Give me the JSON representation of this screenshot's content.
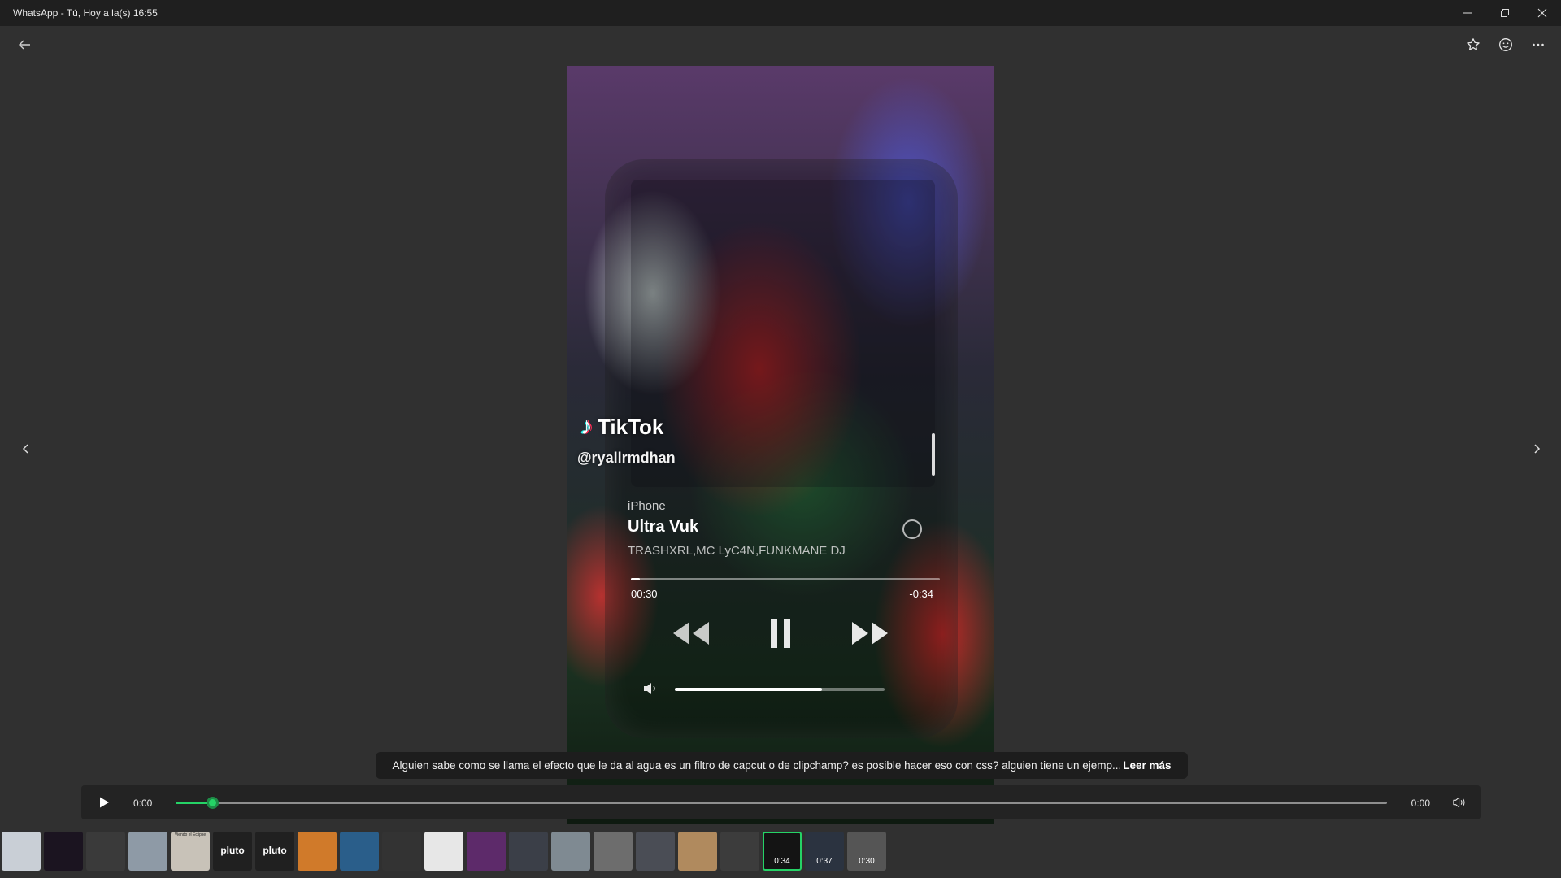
{
  "window": {
    "title": "WhatsApp - Tú, Hoy a la(s) 16:55"
  },
  "video": {
    "tiktok_brand": "TikTok",
    "tiktok_handle": "@ryallrmdhan",
    "now_playing": {
      "device": "iPhone",
      "song": "Ultra Vuk",
      "artists": "TRASHXRL,MC LyC4N,FUNKMANE DJ",
      "elapsed": "00:30",
      "remaining": "-0:34",
      "progress": 0.03,
      "volume": 0.7
    }
  },
  "caption": {
    "text": "Alguien sabe como se llama el efecto que le da al agua es un filtro de capcut o de clipchamp? es posible hacer eso con css? alguien tiene un ejemp...",
    "more_label": "Leer más"
  },
  "player": {
    "current_time": "0:00",
    "total_time": "0:00",
    "progress": 0.03
  },
  "thumbnails": [
    {
      "kind": "screen-light",
      "color": "#c9cfd6",
      "label": ""
    },
    {
      "kind": "dark",
      "color": "#1b1420",
      "label": ""
    },
    {
      "kind": "dark-device",
      "color": "#3a3a3a",
      "label": ""
    },
    {
      "kind": "photo",
      "color": "#8e9aa6",
      "label": ""
    },
    {
      "kind": "photo",
      "color": "#c8c2b8",
      "label": "Viendo el Eclipse"
    },
    {
      "kind": "pluto",
      "color": "#202020",
      "label": "pluto"
    },
    {
      "kind": "pluto",
      "color": "#202020",
      "label": "pluto"
    },
    {
      "kind": "anime",
      "color": "#d07a2a",
      "label": ""
    },
    {
      "kind": "anime-blue",
      "color": "#2a5e8a",
      "label": ""
    },
    {
      "kind": "dark-doc",
      "color": "#333333",
      "label": ""
    },
    {
      "kind": "screen",
      "color": "#e7e7e7",
      "label": ""
    },
    {
      "kind": "purple",
      "color": "#5d2a6a",
      "label": ""
    },
    {
      "kind": "dark-doc",
      "color": "#3b3f48",
      "label": ""
    },
    {
      "kind": "photo",
      "color": "#7f8a92",
      "label": ""
    },
    {
      "kind": "text-light",
      "color": "#6d6d6d",
      "label": ""
    },
    {
      "kind": "list",
      "color": "#4a4d55",
      "label": ""
    },
    {
      "kind": "colorful",
      "color": "#b08a5e",
      "label": ""
    },
    {
      "kind": "avatar",
      "color": "#3c3c3c",
      "label": ""
    },
    {
      "kind": "video",
      "color": "#141414",
      "label": "",
      "duration": "0:34",
      "active": true
    },
    {
      "kind": "video",
      "color": "#2b3340",
      "label": "",
      "duration": "0:37"
    },
    {
      "kind": "video",
      "color": "#555555",
      "label": "",
      "duration": "0:30"
    }
  ],
  "colors": {
    "accent": "#25d366",
    "window_bg": "#303030",
    "titlebar_bg": "#1f1f1f"
  },
  "icons": {
    "back": "arrow-left-icon",
    "star": "star-icon",
    "react": "smiley-icon",
    "more": "more-icon",
    "prev": "chevron-left-icon",
    "next": "chevron-right-icon",
    "play": "play-icon",
    "volume": "volume-icon"
  }
}
